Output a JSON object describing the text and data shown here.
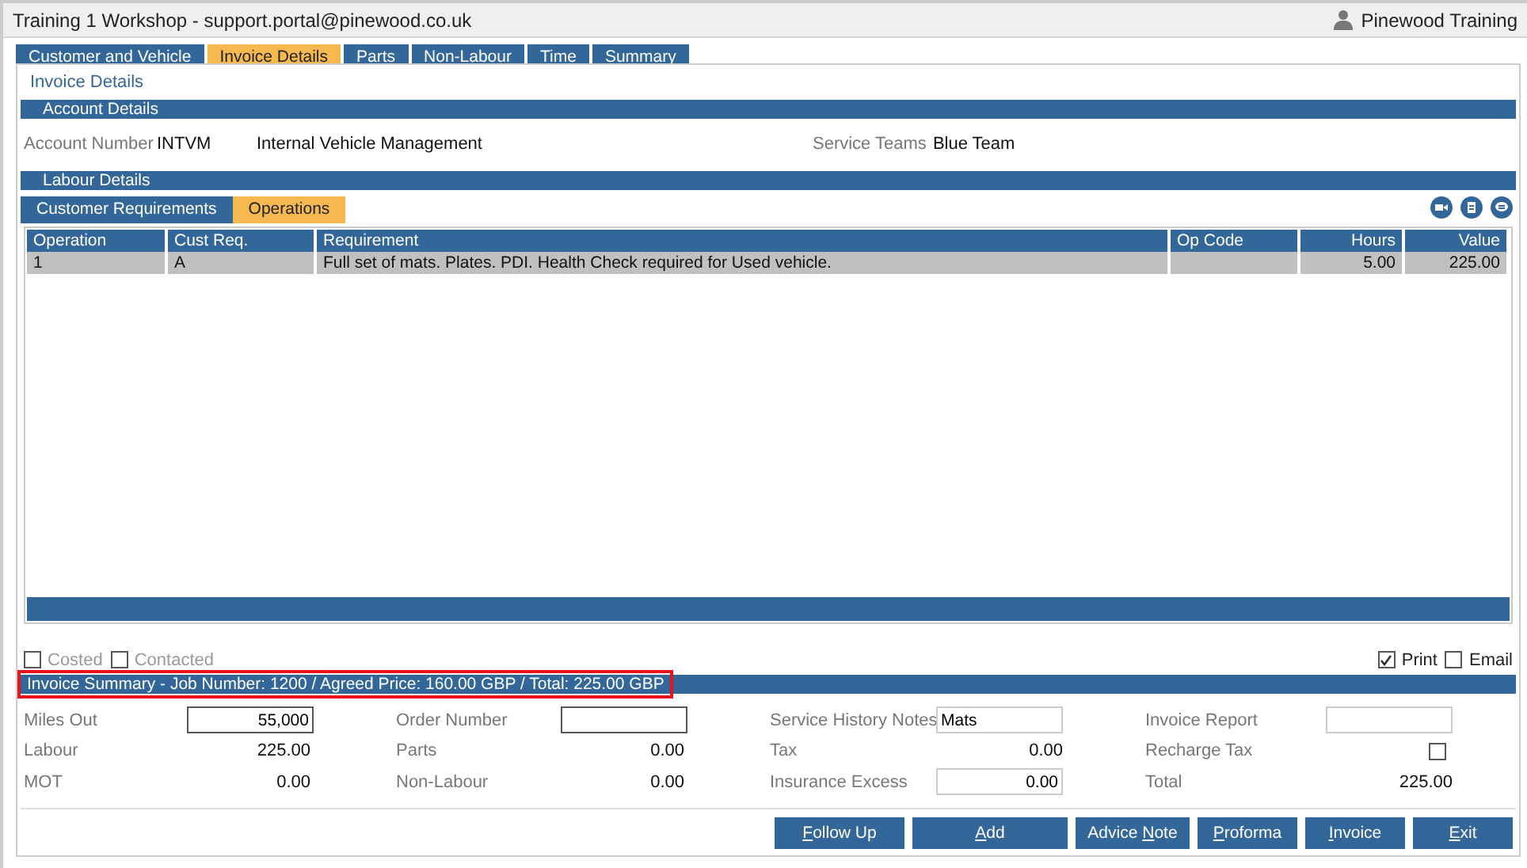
{
  "window": {
    "title": "Training 1 Workshop - support.portal@pinewood.co.uk",
    "user": "Pinewood Training"
  },
  "tabs": [
    {
      "label": "Customer and Vehicle",
      "selected": false
    },
    {
      "label": "Invoice Details",
      "selected": true
    },
    {
      "label": "Parts",
      "selected": false
    },
    {
      "label": "Non-Labour",
      "selected": false
    },
    {
      "label": "Time",
      "selected": false
    },
    {
      "label": "Summary",
      "selected": false
    }
  ],
  "page_heading": "Invoice Details",
  "account_details": {
    "title": "Account Details",
    "account_number_label": "Account Number",
    "account_number": "INTVM",
    "account_name": "Internal Vehicle Management",
    "service_teams_label": "Service Teams",
    "service_teams": "Blue Team"
  },
  "labour_details": {
    "title": "Labour Details",
    "subtabs": [
      {
        "label": "Customer Requirements",
        "selected": false
      },
      {
        "label": "Operations",
        "selected": true
      }
    ],
    "table": {
      "columns": [
        "Operation",
        "Cust Req.",
        "Requirement",
        "Op Code",
        "Hours",
        "Value"
      ],
      "rows": [
        {
          "cells": [
            "1",
            "A",
            "Full set of mats. Plates. PDI. Health Check required for Used vehicle.",
            "",
            "5.00",
            "225.00"
          ],
          "selected": true
        }
      ]
    }
  },
  "options": [
    {
      "label": "Costed",
      "checked": false
    },
    {
      "label": "Contacted",
      "checked": false
    },
    {
      "label": "Print",
      "checked": true
    },
    {
      "label": "Email",
      "checked": false
    }
  ],
  "invoice_summary": {
    "title": "Invoice Summary - Job Number: 1200 / Agreed Price: 160.00 GBP / Total: 225.00 GBP",
    "highlighted": true,
    "fields": [
      {
        "label": "Miles Out",
        "kind": "number_input",
        "value": "55,000"
      },
      {
        "label": "Order Number",
        "kind": "input"
      },
      {
        "label": "Service History Notes",
        "kind": "input",
        "value": "Mats"
      },
      {
        "label": "Invoice Report",
        "kind": "input"
      },
      {
        "label": "Labour",
        "kind": "text",
        "value": "225.00"
      },
      {
        "label": "Parts",
        "kind": "text",
        "value": "0.00"
      },
      {
        "label": "Tax",
        "kind": "text",
        "value": "0.00"
      },
      {
        "label": "Recharge Tax",
        "kind": "checkbox",
        "checked": false
      },
      {
        "label": "MOT",
        "kind": "text",
        "value": "0.00"
      },
      {
        "label": "Non-Labour",
        "kind": "text",
        "value": "0.00"
      },
      {
        "label": "Insurance Excess",
        "kind": "number_input",
        "value": "0.00"
      },
      {
        "label": "Total",
        "kind": "text",
        "value": "225.00"
      }
    ]
  },
  "buttons": [
    {
      "key": "F",
      "after": "ollow Up"
    },
    {
      "key": "A",
      "after": "dd"
    },
    {
      "before": "Advice ",
      "key": "N",
      "after": "ote"
    },
    {
      "key": "P",
      "after": "roforma"
    },
    {
      "key": "I",
      "after": "nvoice"
    },
    {
      "key": "E",
      "after": "xit"
    }
  ]
}
